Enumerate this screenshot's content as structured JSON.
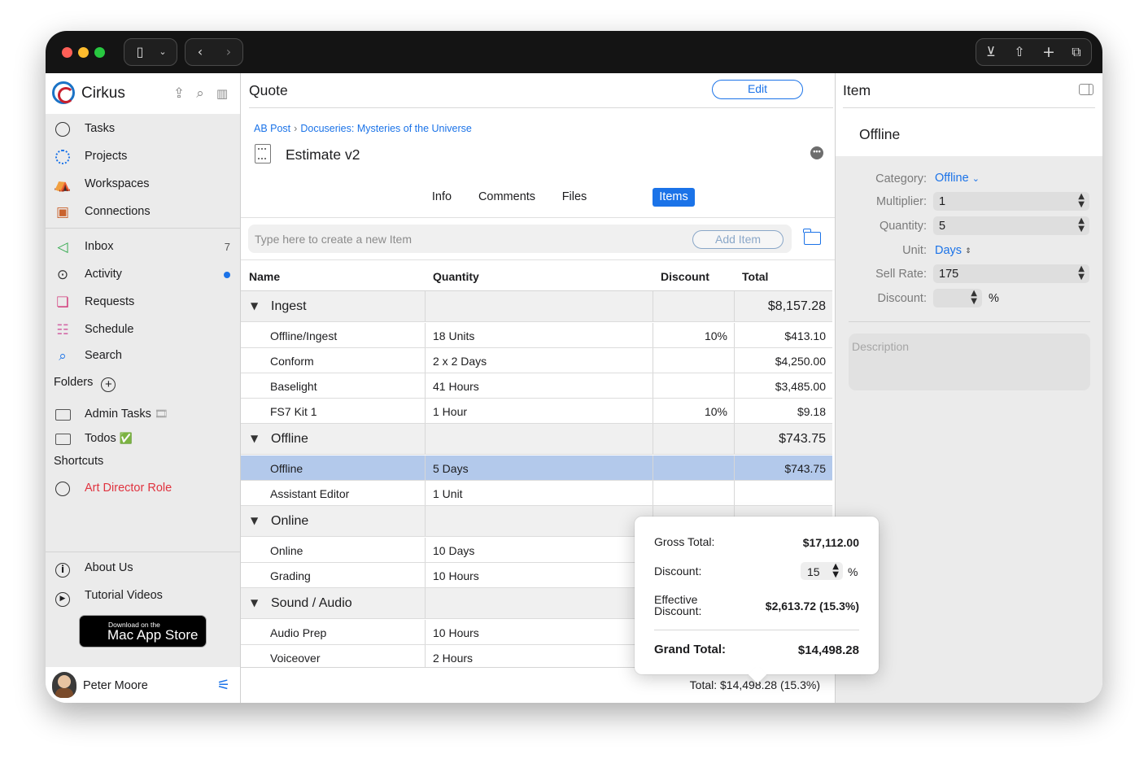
{
  "titlebar": {
    "traffic_colors": [
      "#ff5f57",
      "#febc2e",
      "#28c840"
    ],
    "icons": [
      "sidebar-toggle-icon",
      "chevron-down-icon",
      "back-icon",
      "forward-icon",
      "download-icon",
      "share-icon",
      "plus-icon",
      "tabs-icon"
    ]
  },
  "sidebar": {
    "app_name": "Cirkus",
    "nav": [
      {
        "label": "Tasks",
        "icon": "circle-icon"
      },
      {
        "label": "Projects",
        "icon": "dotted-circle-icon"
      },
      {
        "label": "Workspaces",
        "icon": "tent-icon"
      },
      {
        "label": "Connections",
        "icon": "contact-card-icon"
      }
    ],
    "nav2": [
      {
        "label": "Inbox",
        "badge": "7",
        "icon": "megaphone-icon"
      },
      {
        "label": "Activity",
        "icon": "tape-icon"
      },
      {
        "label": "Requests",
        "icon": "cards-icon"
      },
      {
        "label": "Schedule",
        "icon": "signpost-icon"
      },
      {
        "label": "Search",
        "icon": "search-icon"
      }
    ],
    "folders_title": "Folders",
    "folders": [
      {
        "label": "Admin Tasks",
        "emoji": "🎞"
      },
      {
        "label": "Todos",
        "emoji": "✅"
      }
    ],
    "shortcuts_title": "Shortcuts",
    "shortcuts": [
      {
        "label": "Art Director Role",
        "color": "#e0333f"
      }
    ],
    "bottom": [
      {
        "label": "About Us",
        "icon": "info-icon"
      },
      {
        "label": "Tutorial Videos",
        "icon": "play-icon"
      }
    ],
    "appstore": {
      "small": "Download on the",
      "big": "Mac App Store"
    },
    "user": {
      "name": "Peter Moore"
    }
  },
  "main": {
    "title": "Quote",
    "edit_label": "Edit",
    "breadcrumb": [
      "AB Post",
      "Docuseries: Mysteries of the Universe"
    ],
    "breadcrumb_sep": "›",
    "doc_title": "Estimate v2",
    "tabs": [
      "Info",
      "Comments",
      "Files",
      "Items"
    ],
    "active_tab": "Items",
    "new_item_placeholder": "Type here to create a new Item",
    "add_item_label": "Add Item",
    "columns": [
      "Name",
      "Quantity",
      "Discount",
      "Total"
    ],
    "groups": [
      {
        "name": "Ingest",
        "total": "$8,157.28",
        "items": [
          {
            "name": "Offline/Ingest",
            "quantity": "18 Units",
            "discount": "10%",
            "total": "$413.10"
          },
          {
            "name": "Conform",
            "quantity": "2 x 2 Days",
            "discount": "",
            "total": "$4,250.00"
          },
          {
            "name": "Baselight",
            "quantity": "41 Hours",
            "discount": "",
            "total": "$3,485.00"
          },
          {
            "name": "FS7 Kit 1",
            "quantity": "1 Hour",
            "discount": "10%",
            "total": "$9.18"
          }
        ]
      },
      {
        "name": "Offline",
        "total": "$743.75",
        "items": [
          {
            "name": "Offline",
            "quantity": "5 Days",
            "discount": "",
            "total": "$743.75",
            "selected": true
          },
          {
            "name": "Assistant Editor",
            "quantity": "1 Unit",
            "discount": "",
            "total": ""
          }
        ]
      },
      {
        "name": "Online",
        "total": "",
        "items": [
          {
            "name": "Online",
            "quantity": "10 Days",
            "discount": "",
            "total": ""
          },
          {
            "name": "Grading",
            "quantity": "10 Hours",
            "discount": "",
            "total": ""
          }
        ]
      },
      {
        "name": "Sound / Audio",
        "total": "",
        "items": [
          {
            "name": "Audio Prep",
            "quantity": "10 Hours",
            "discount": "",
            "total": ""
          },
          {
            "name": "Voiceover",
            "quantity": "2 Hours",
            "discount": "",
            "total": ""
          }
        ]
      }
    ],
    "footer_total": "Total: $14,498.28 (15.3%)"
  },
  "inspector": {
    "title": "Item",
    "item_name": "Offline",
    "fields": {
      "category": {
        "label": "Category:",
        "value": "Offline"
      },
      "multiplier": {
        "label": "Multiplier:",
        "value": "1"
      },
      "quantity": {
        "label": "Quantity:",
        "value": "5"
      },
      "unit": {
        "label": "Unit:",
        "value": "Days"
      },
      "sell_rate": {
        "label": "Sell Rate:",
        "value": "175"
      },
      "discount": {
        "label": "Discount:",
        "value": "",
        "suffix": "%"
      }
    },
    "description_placeholder": "Description"
  },
  "popover": {
    "gross_label": "Gross Total:",
    "gross_value": "$17,112.00",
    "discount_label": "Discount:",
    "discount_value": "15",
    "discount_suffix": "%",
    "effective_label": "Effective\nDiscount:",
    "effective_value": "$2,613.72 (15.3%)",
    "grand_label": "Grand Total:",
    "grand_value": "$14,498.28"
  },
  "colors": {
    "accent": "#1b73e8",
    "selection": "#b3c9eb",
    "shortcut_red": "#e0333f"
  }
}
